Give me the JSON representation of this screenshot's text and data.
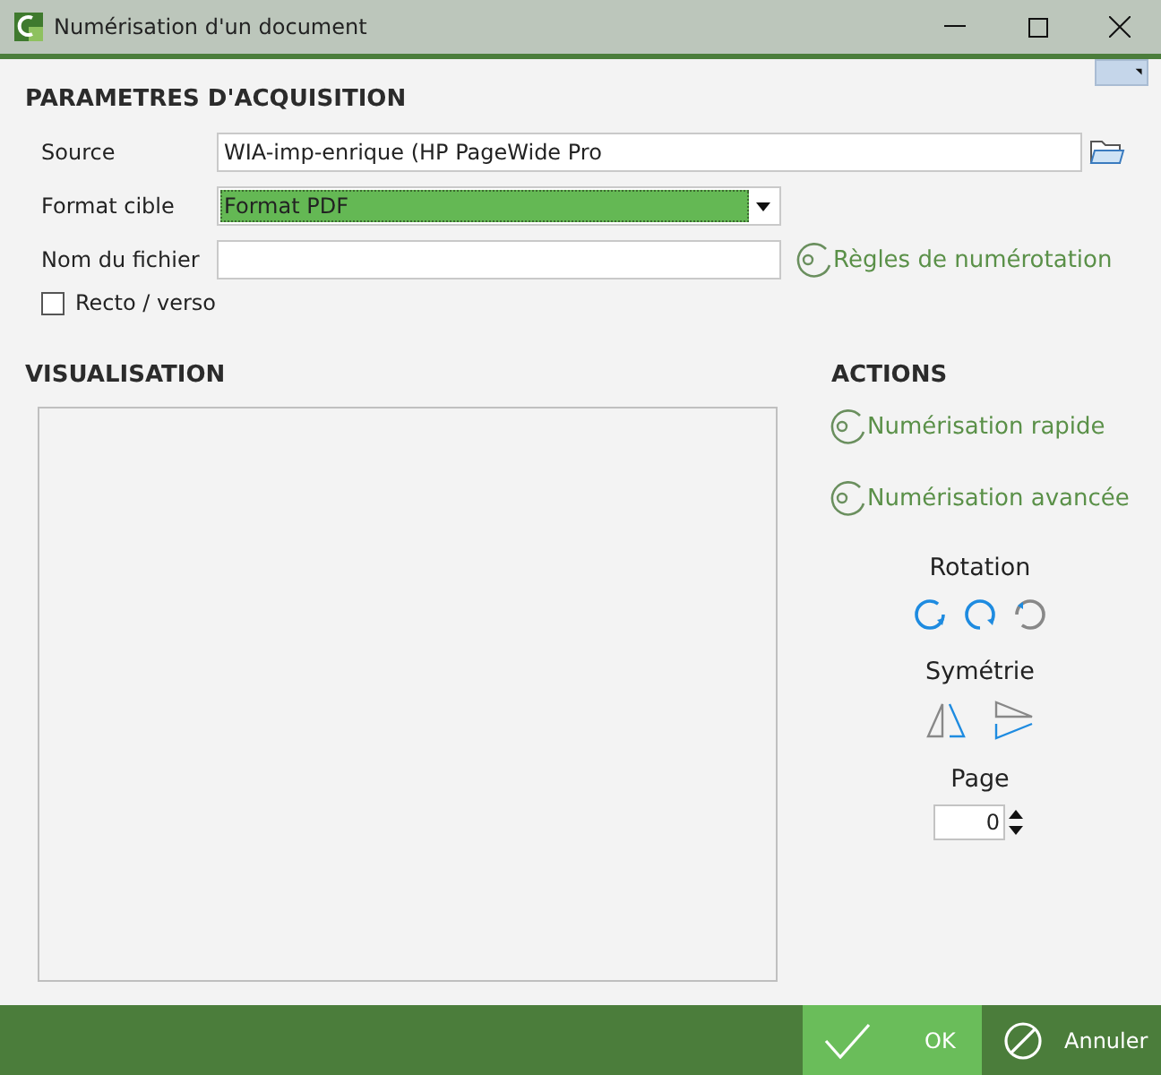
{
  "window": {
    "title": "Numérisation d'un document"
  },
  "acquisition": {
    "heading": "PARAMETRES D'ACQUISITION",
    "source": {
      "label": "Source",
      "value": "WIA-imp-enrique (HP PageWide Pro"
    },
    "format": {
      "label": "Format cible",
      "value": "Format PDF"
    },
    "filename": {
      "label": "Nom du fichier"
    },
    "rules_link": "Règles de numérotation",
    "duplex": {
      "label": "Recto / verso",
      "checked": false
    }
  },
  "preview": {
    "heading": "VISUALISATION"
  },
  "actions": {
    "heading": "ACTIONS",
    "links": [
      "Numérisation rapide",
      "Numérisation avancée"
    ],
    "rotation_label": "Rotation",
    "symmetry_label": "Symétrie",
    "page_label": "Page",
    "page_value": "0"
  },
  "buttons": [
    {
      "kind": "ok",
      "label": "OK"
    },
    {
      "kind": "cancel",
      "label": "Annuler"
    }
  ]
}
